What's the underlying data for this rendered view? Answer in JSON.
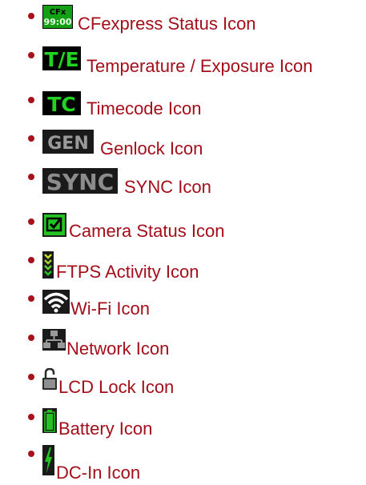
{
  "list": {
    "items": [
      {
        "label": "CFexpress Status Icon",
        "icon": "cfexpress-status-icon",
        "icon_text_top": "CFx",
        "icon_text_bottom": "99:00"
      },
      {
        "label": "Temperature / Exposure Icon",
        "icon": "temperature-exposure-icon",
        "icon_text": "T/E"
      },
      {
        "label": "Timecode Icon",
        "icon": "timecode-icon",
        "icon_text": "TC"
      },
      {
        "label": "Genlock Icon",
        "icon": "genlock-icon",
        "icon_text": "GEN"
      },
      {
        "label": "SYNC Icon",
        "icon": "sync-icon",
        "icon_text": "SYNC"
      },
      {
        "label": "Camera Status Icon",
        "icon": "camera-status-icon"
      },
      {
        "label": "FTPS Activity Icon",
        "icon": "ftps-activity-icon"
      },
      {
        "label": "Wi-Fi Icon",
        "icon": "wifi-icon"
      },
      {
        "label": "Network Icon",
        "icon": "network-icon"
      },
      {
        "label": "LCD Lock Icon",
        "icon": "lcd-lock-icon"
      },
      {
        "label": "Battery Icon",
        "icon": "battery-icon"
      },
      {
        "label": "DC-In Icon",
        "icon": "dc-in-icon"
      }
    ]
  },
  "colors": {
    "link": "#a30e1a",
    "bullet": "#a8101c",
    "status_green": "#1fd11f",
    "icon_gray": "#9a9a9a"
  }
}
